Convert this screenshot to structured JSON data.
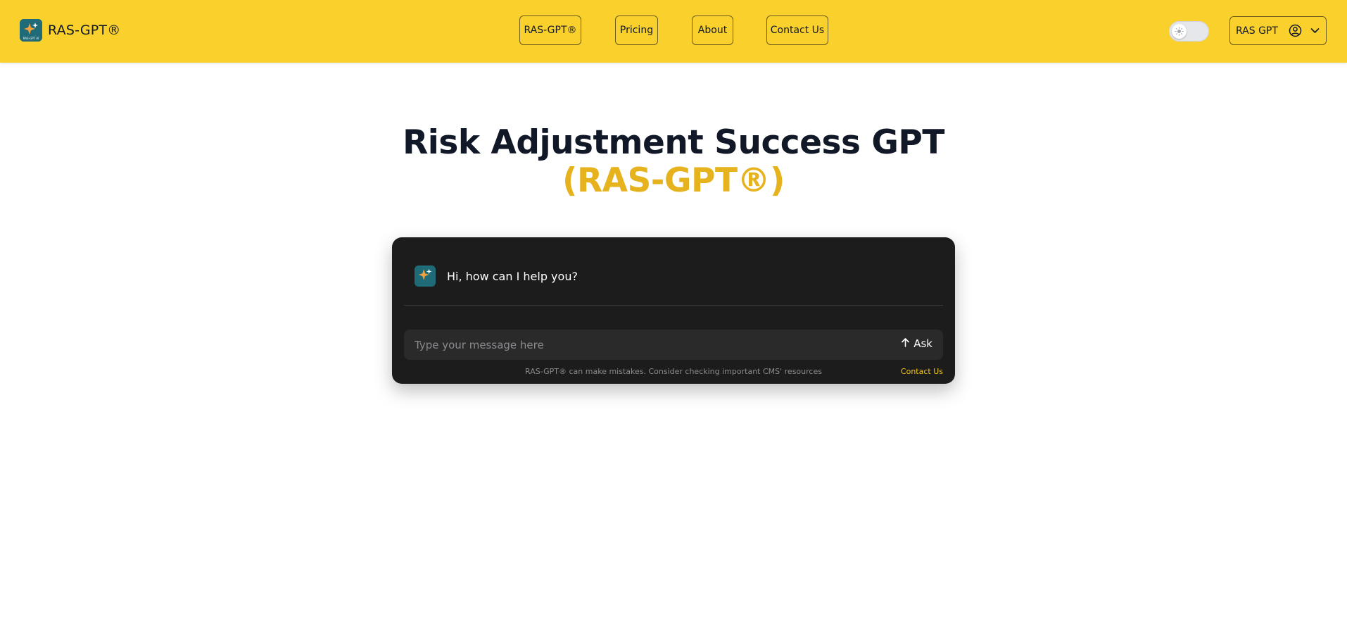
{
  "header": {
    "brand_name": "RAS-GPT®",
    "logo_caption": "RAS-GPT AI",
    "nav": [
      {
        "label": "RAS-GPT®"
      },
      {
        "label": "Pricing"
      },
      {
        "label": "About"
      },
      {
        "label": "Contact Us"
      }
    ],
    "theme_toggle_icon": "sun-icon",
    "user_menu": {
      "label": "RAS GPT",
      "icon": "user-circle-icon",
      "chevron": "chevron-down-icon"
    }
  },
  "hero": {
    "title_line1": "Risk Adjustment Success GPT",
    "title_line2": "(RAS-GPT®)"
  },
  "chat": {
    "greeting": "Hi, how can I help you?",
    "input_value": "",
    "input_placeholder": "Type your message here",
    "ask_label": "Ask",
    "ask_icon": "arrow-up-icon",
    "disclaimer": "RAS-GPT® can make mistakes. Consider checking important CMS' resources",
    "contact_link": "Contact Us"
  },
  "colors": {
    "header_bg": "#fad02c",
    "accent": "#e6b21d",
    "card_bg": "#1c1c1d",
    "link": "#f5c518"
  }
}
